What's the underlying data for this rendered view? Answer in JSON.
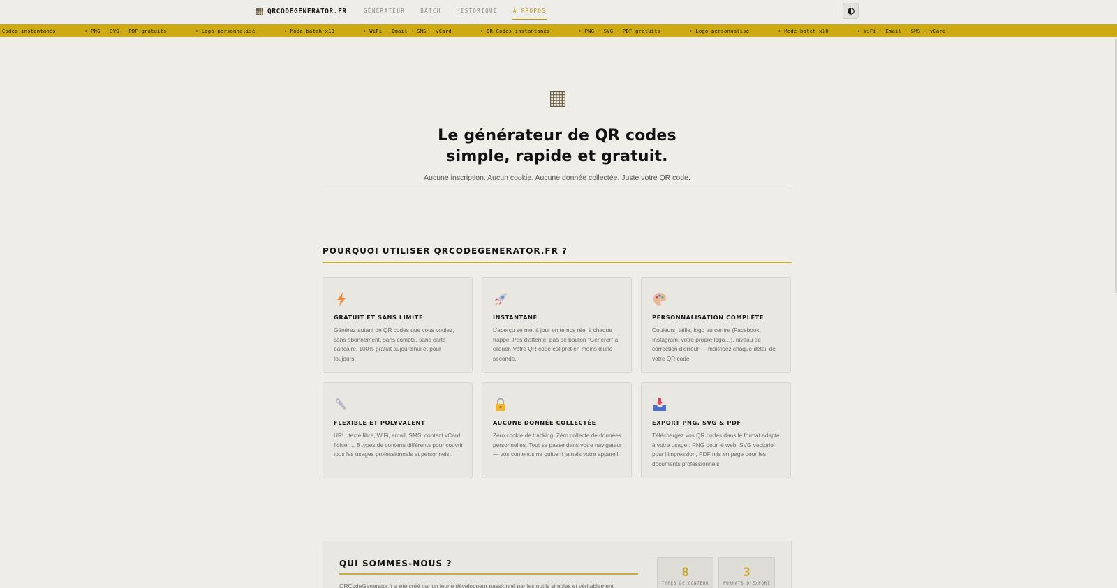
{
  "nav": {
    "logo": "QRCODEGENERATOR.FR",
    "links": [
      {
        "label": "GÉNÉRATEUR",
        "active": false
      },
      {
        "label": "BATCH",
        "active": false
      },
      {
        "label": "HISTORIQUE",
        "active": false
      },
      {
        "label": "À PROPOS",
        "active": true
      }
    ],
    "theme_toggle_icon": "half-circle-icon"
  },
  "ticker": {
    "items": [
      "Codes instantanés",
      "• PNG · SVG · PDF gratuits",
      "• Logo personnalisé",
      "• Mode batch x10",
      "• WiFi · Email · SMS · vCard",
      "• QR Codes instantanés",
      "• PNG · SVG · PDF gratuits",
      "• Logo personnalisé",
      "• Mode batch x10",
      "• WiFi · Email · SMS · vCard"
    ]
  },
  "hero": {
    "icon": "qr-grid-icon",
    "title_line1": "Le générateur de QR codes",
    "title_line2": "simple, rapide et gratuit.",
    "subtitle": "Aucune inscription. Aucun cookie. Aucune donnée collectée. Juste votre QR code."
  },
  "features": {
    "title": "POURQUOI UTILISER QRCODEGENERATOR.FR ?",
    "cards": [
      {
        "icon": "lightning-icon",
        "title": "GRATUIT ET SANS LIMITE",
        "text": "Générez autant de QR codes que vous voulez, sans abonnement, sans compte, sans carte bancaire. 100% gratuit aujourd'hui et pour toujours."
      },
      {
        "icon": "rocket-icon",
        "title": "INSTANTANÉ",
        "text": "L'aperçu se met à jour en temps réel à chaque frappe. Pas d'attente, pas de bouton \"Générer\" à cliquer. Votre QR code est prêt en moins d'une seconde."
      },
      {
        "icon": "palette-icon",
        "title": "PERSONNALISATION COMPLÈTE",
        "text": "Couleurs, taille, logo au centre (Facebook, Instagram, votre propre logo…), niveau de correction d'erreur — maîtrisez chaque détail de votre QR code."
      },
      {
        "icon": "wrench-icon",
        "title": "FLEXIBLE ET POLYVALENT",
        "text": "URL, texte libre, WiFi, email, SMS, contact vCard, fichier… 8 types de contenu différents pour couvrir tous les usages professionnels et personnels."
      },
      {
        "icon": "lock-icon",
        "title": "AUCUNE DONNÉE COLLECTÉE",
        "text": "Zéro cookie de tracking. Zéro collecte de données personnelles. Tout se passe dans votre navigateur — vos contenus ne quittent jamais votre appareil."
      },
      {
        "icon": "inbox-tray-icon",
        "title": "EXPORT PNG, SVG & PDF",
        "text": "Téléchargez vos QR codes dans le format adapté à votre usage : PNG pour le web, SVG vectoriel pour l'impression, PDF mis en page pour les documents professionnels."
      }
    ]
  },
  "about": {
    "title": "QUI SOMMES-NOUS ?",
    "text": "QRCodeGenerator.fr a été créé par un jeune développeur passionné par les outils simples et véritablement",
    "stats": [
      {
        "number": "8",
        "label": "TYPES DE CONTENU"
      },
      {
        "number": "3",
        "label": "FORMATS D'EXPORT"
      }
    ]
  },
  "colors": {
    "accent": "#cdaa12",
    "background": "#efede8",
    "card": "#e9e7e2"
  }
}
